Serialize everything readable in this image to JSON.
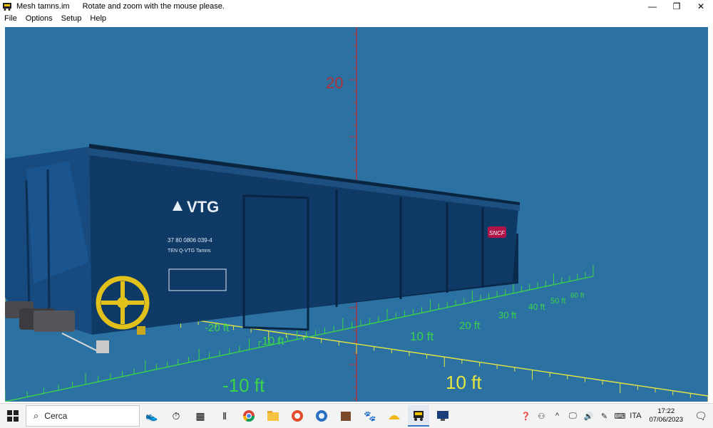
{
  "window": {
    "title": "Mesh tamns.im",
    "message": "Rotate and zoom with the mouse please.",
    "controls": {
      "minimize": "—",
      "restore": "❐",
      "close": "✕"
    }
  },
  "menu": [
    "File",
    "Options",
    "Setup",
    "Help"
  ],
  "scene": {
    "background": "#2b72a3",
    "axis_labels": {
      "z_20": "20",
      "x_neg20": "-20 ft",
      "x_neg10": "-10 ft",
      "x_10": "10 ft",
      "x_20": "20 ft",
      "x_30": "30 ft",
      "x_40": "40 ft",
      "x_50": "50 ft",
      "x_60": "60 ft",
      "y_neg10": "-10 ft",
      "y_10": "10 ft"
    },
    "colors": {
      "z_axis": "#b0303a",
      "x_axis": "#3cd24a",
      "y_axis": "#e6e640",
      "car_body": "#0f3a66",
      "wheel": "#e2c21a"
    },
    "car": {
      "brand": "VTG",
      "number_line": "37 80 0806 039-4",
      "type_line": "TEN Q-VTG Tamns",
      "operator_logo": "SNCF"
    }
  },
  "taskbar": {
    "search_placeholder": "Cerca",
    "language": "ITA",
    "time": "17:22",
    "date": "07/06/2023"
  }
}
